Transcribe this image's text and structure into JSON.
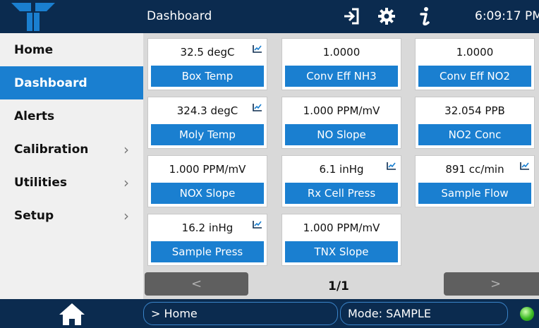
{
  "header": {
    "title": "Dashboard",
    "clock": "6:09:17 PM",
    "icons": [
      "logo-icon",
      "sign-in-icon",
      "gear-icon",
      "info-icon"
    ]
  },
  "sidebar": {
    "items": [
      {
        "label": "Home",
        "chevron": false,
        "active": false
      },
      {
        "label": "Dashboard",
        "chevron": false,
        "active": true
      },
      {
        "label": "Alerts",
        "chevron": false,
        "active": false
      },
      {
        "label": "Calibration",
        "chevron": true,
        "active": false
      },
      {
        "label": "Utilities",
        "chevron": true,
        "active": false
      },
      {
        "label": "Setup",
        "chevron": true,
        "active": false
      }
    ],
    "chevron_glyph": "›"
  },
  "tiles": [
    {
      "value": "32.5 degC",
      "label": "Box Temp",
      "chart_icon": true
    },
    {
      "value": "1.0000",
      "label": "Conv Eff NH3",
      "chart_icon": false
    },
    {
      "value": "1.0000",
      "label": "Conv Eff NO2",
      "chart_icon": false
    },
    {
      "value": "324.3 degC",
      "label": "Moly Temp",
      "chart_icon": true
    },
    {
      "value": "1.000 PPM/mV",
      "label": "NO Slope",
      "chart_icon": false
    },
    {
      "value": "32.054 PPB",
      "label": "NO2 Conc",
      "chart_icon": false
    },
    {
      "value": "1.000 PPM/mV",
      "label": "NOX Slope",
      "chart_icon": false
    },
    {
      "value": "6.1 inHg",
      "label": "Rx Cell Press",
      "chart_icon": true
    },
    {
      "value": "891 cc/min",
      "label": "Sample Flow",
      "chart_icon": true
    },
    {
      "value": "16.2 inHg",
      "label": "Sample Press",
      "chart_icon": true
    },
    {
      "value": "1.000 PPM/mV",
      "label": "TNX Slope",
      "chart_icon": false
    }
  ],
  "pager": {
    "prev": "<",
    "next": ">",
    "page": "1/1"
  },
  "footer": {
    "breadcrumb": "> Home",
    "mode": "Mode: SAMPLE",
    "status_color": "#3dbb25"
  },
  "colors": {
    "navy": "#0b2b4f",
    "accent": "#1a7fd0",
    "panel": "#d9d9d9"
  }
}
